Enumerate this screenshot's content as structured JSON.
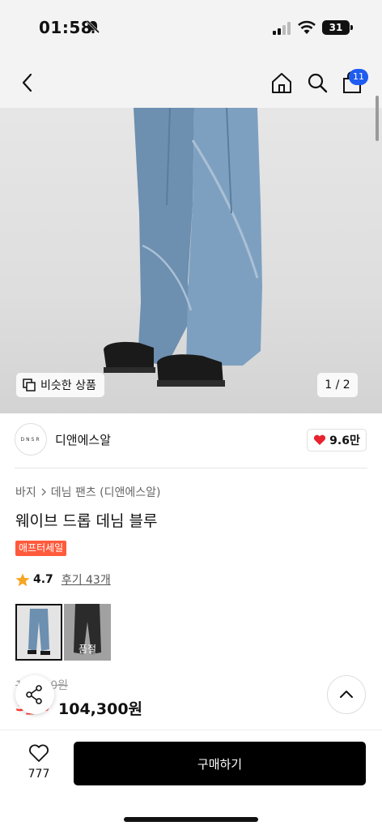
{
  "status_bar": {
    "time": "01:58",
    "battery": "31"
  },
  "nav": {
    "cart_count": "11",
    "icons": [
      "back-icon",
      "home-icon",
      "search-icon",
      "shopping-bag-icon"
    ]
  },
  "hero": {
    "similar_label": "비슷한 상품",
    "pager": "1 / 2"
  },
  "brand": {
    "logo_text": "DNSR",
    "name": "디앤에스알",
    "likes": "9.6만"
  },
  "product": {
    "breadcrumb": [
      "바지",
      "데님 팬츠 (디앤에스알)"
    ],
    "title": "웨이브 드롭 데님 블루",
    "tag": "애프터세일",
    "rating": "4.7",
    "reviews": "후기 43개",
    "thumbnails": [
      {
        "name": "blue"
      },
      {
        "name": "black",
        "soldout": "품절"
      }
    ],
    "original_price": "1__,_00원",
    "discount": "3_%",
    "price": "104,300원"
  },
  "bottom": {
    "wish_count": "777",
    "buy_label": "구매하기"
  },
  "colors": {
    "accent": "#1f5cf0",
    "sale": "#ff5a3c",
    "heart": "#e8222e",
    "buy": "#000000"
  }
}
